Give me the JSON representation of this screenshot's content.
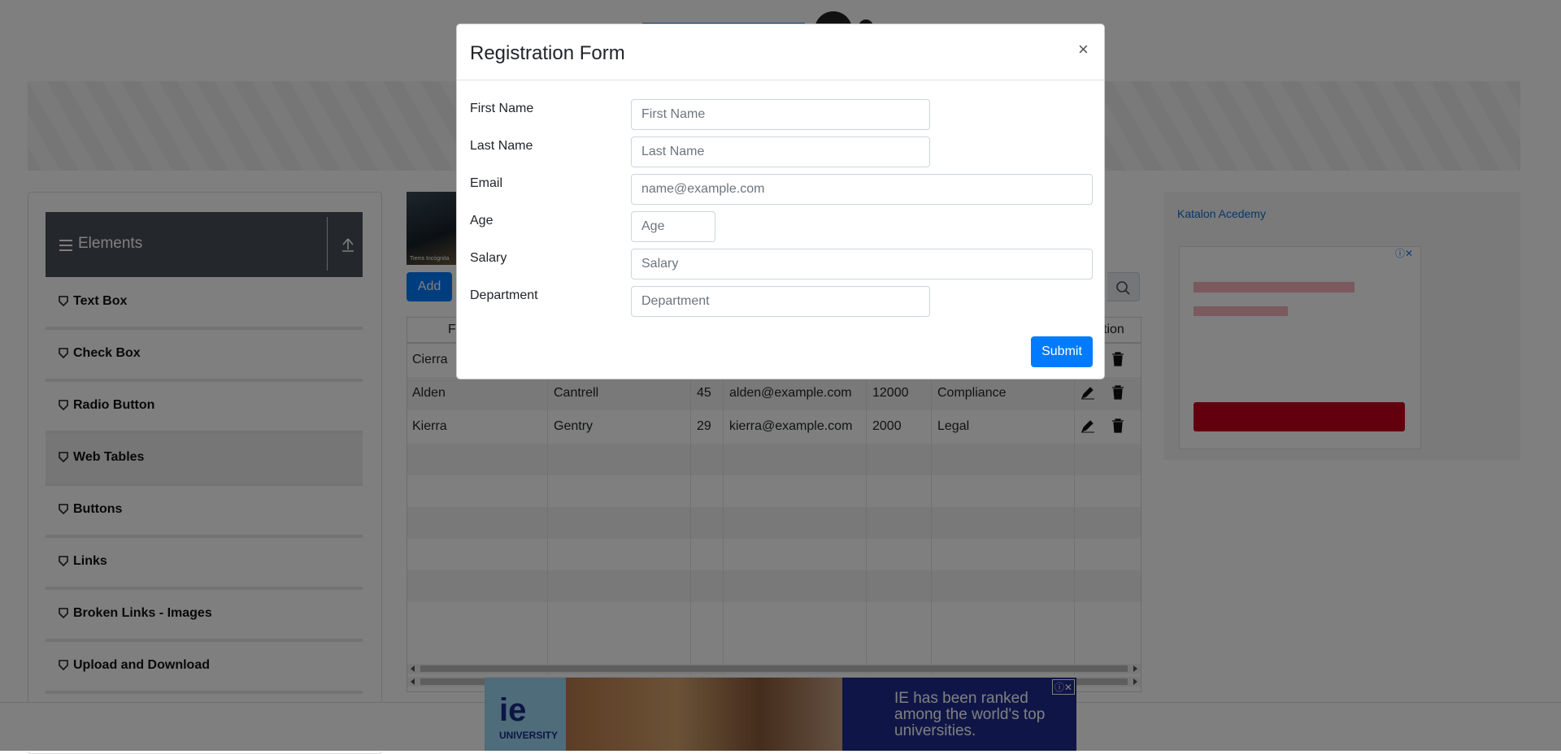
{
  "sidebar": {
    "group_title": "Elements",
    "items": [
      {
        "label": "Text Box"
      },
      {
        "label": "Check Box"
      },
      {
        "label": "Radio Button"
      },
      {
        "label": "Web Tables",
        "active": true
      },
      {
        "label": "Buttons"
      },
      {
        "label": "Links"
      },
      {
        "label": "Broken Links - Images"
      },
      {
        "label": "Upload and Download"
      }
    ]
  },
  "main": {
    "add_label": "Add",
    "thumbnail_caption": "Tierra Incógnita",
    "table": {
      "headers": [
        "Fi",
        "tion"
      ],
      "rows": [
        {
          "first": "Cierra",
          "last": "",
          "age": "",
          "email": "",
          "salary": "",
          "department": ""
        },
        {
          "first": "Alden",
          "last": "Cantrell",
          "age": "45",
          "email": "alden@example.com",
          "salary": "12000",
          "department": "Compliance"
        },
        {
          "first": "Kierra",
          "last": "Gentry",
          "age": "29",
          "email": "kierra@example.com",
          "salary": "2000",
          "department": "Legal"
        }
      ]
    }
  },
  "ads": {
    "right_image_alt": "Katalon Acedemy",
    "bottom_brand": "ie",
    "bottom_brand_sub": "UNIVERSITY",
    "bottom_text": "IE has been ranked among the world's top universities."
  },
  "modal": {
    "title": "Registration Form",
    "close": "×",
    "fields": {
      "first_name": {
        "label": "First Name",
        "placeholder": "First Name"
      },
      "last_name": {
        "label": "Last Name",
        "placeholder": "Last Name"
      },
      "email": {
        "label": "Email",
        "placeholder": "name@example.com"
      },
      "age": {
        "label": "Age",
        "placeholder": "Age"
      },
      "salary": {
        "label": "Salary",
        "placeholder": "Salary"
      },
      "department": {
        "label": "Department",
        "placeholder": "Department"
      }
    },
    "submit_label": "Submit"
  },
  "colors": {
    "primary": "#007bff",
    "sidebar_header": "#495058",
    "ad_red": "#c4001a",
    "ad_blue": "#1f2d8f"
  }
}
